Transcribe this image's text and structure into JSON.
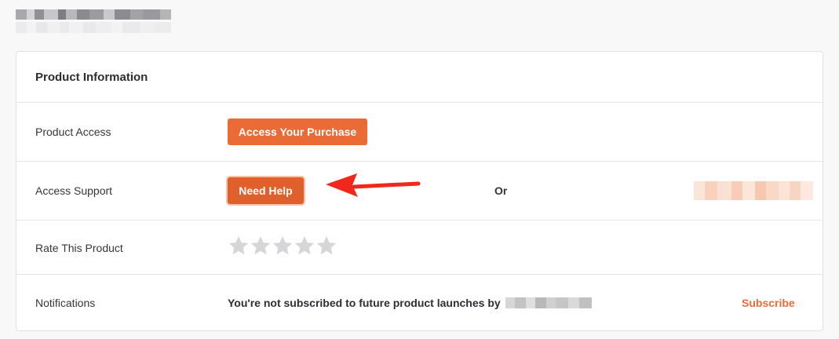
{
  "card": {
    "title": "Product Information"
  },
  "rows": {
    "product_access": {
      "label": "Product Access",
      "button": "Access Your Purchase"
    },
    "access_support": {
      "label": "Access Support",
      "button": "Need Help",
      "or_text": "Or"
    },
    "rate": {
      "label": "Rate This Product",
      "rating": 0,
      "max_rating": 5
    },
    "notifications": {
      "label": "Notifications",
      "message": "You're not subscribed to future product launches by",
      "subscribe": "Subscribe"
    }
  },
  "colors": {
    "accent": "#ea6b36",
    "annotation_arrow": "#f0281c",
    "star_empty": "#d6d6d8"
  },
  "icons": {
    "star": "star-icon",
    "arrow": "annotation-arrow-icon"
  }
}
